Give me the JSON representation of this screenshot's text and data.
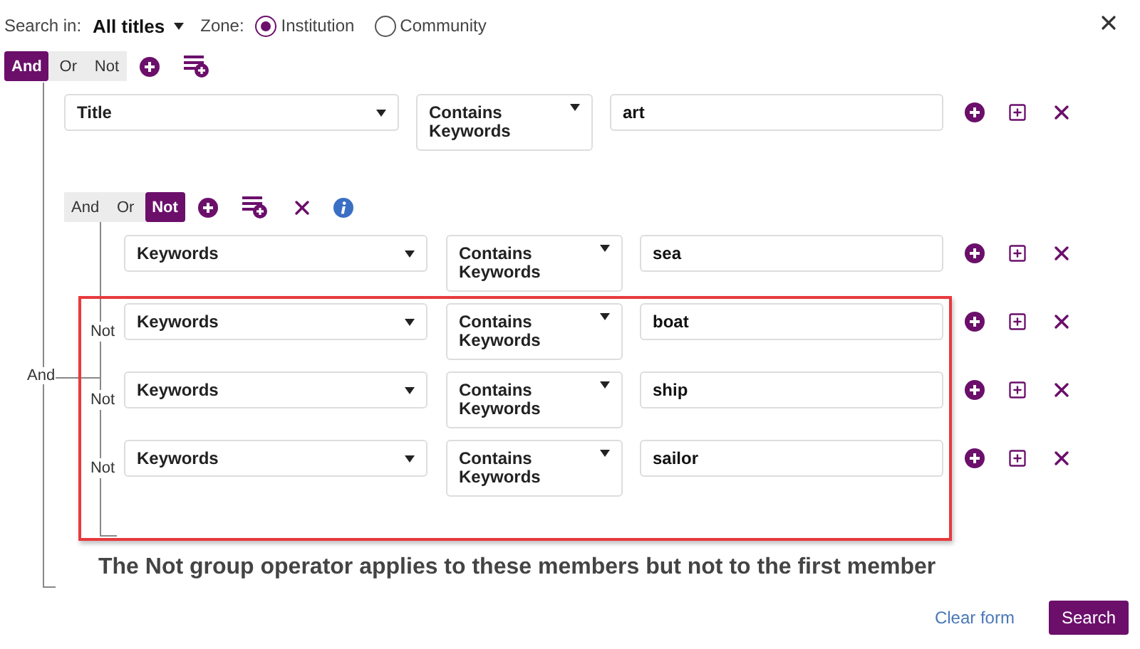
{
  "search_in": {
    "label": "Search in:",
    "value": "All titles"
  },
  "zone": {
    "label": "Zone:",
    "options": [
      {
        "label": "Institution",
        "selected": true
      },
      {
        "label": "Community",
        "selected": false
      }
    ]
  },
  "root": {
    "operators": [
      {
        "label": "And",
        "selected": true
      },
      {
        "label": "Or",
        "selected": false
      },
      {
        "label": "Not",
        "selected": false
      }
    ],
    "connector": "And",
    "conditions": [
      {
        "field": "Title",
        "operator": "Contains Keywords",
        "value": "art"
      }
    ],
    "group": {
      "operators": [
        {
          "label": "And",
          "selected": false
        },
        {
          "label": "Or",
          "selected": false
        },
        {
          "label": "Not",
          "selected": true
        }
      ],
      "conditions": [
        {
          "field": "Keywords",
          "operator": "Contains Keywords",
          "value": "sea"
        },
        {
          "connector": "Not",
          "field": "Keywords",
          "operator": "Contains Keywords",
          "value": "boat"
        },
        {
          "connector": "Not",
          "field": "Keywords",
          "operator": "Contains Keywords",
          "value": "ship"
        },
        {
          "connector": "Not",
          "field": "Keywords",
          "operator": "Contains Keywords",
          "value": "sailor"
        }
      ]
    }
  },
  "annotation": "The Not group operator applies to these members but not to the first member",
  "footer": {
    "clear": "Clear form",
    "search": "Search"
  }
}
